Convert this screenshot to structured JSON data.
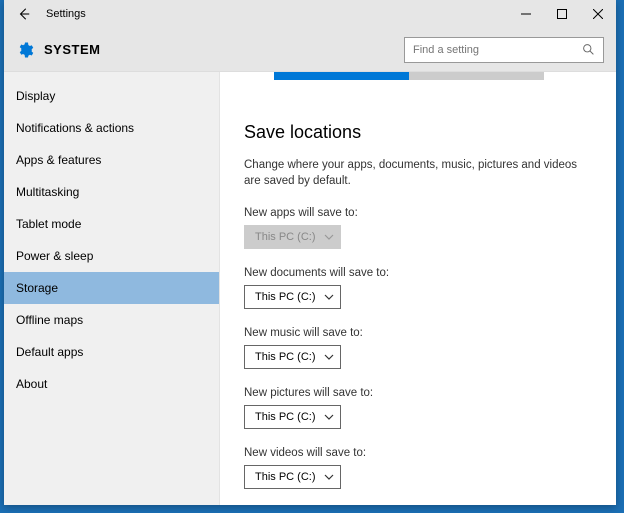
{
  "titlebar": {
    "title": "Settings"
  },
  "header": {
    "title": "SYSTEM"
  },
  "search": {
    "placeholder": "Find a setting"
  },
  "sidebar": {
    "items": [
      "Display",
      "Notifications & actions",
      "Apps & features",
      "Multitasking",
      "Tablet mode",
      "Power & sleep",
      "Storage",
      "Offline maps",
      "Default apps",
      "About"
    ],
    "selected_index": 6
  },
  "main": {
    "title": "Save locations",
    "description": "Change where your apps, documents, music, pictures and videos are saved by default.",
    "settings": [
      {
        "label": "New apps will save to:",
        "value": "This PC (C:)",
        "disabled": true
      },
      {
        "label": "New documents will save to:",
        "value": "This PC (C:)",
        "disabled": false
      },
      {
        "label": "New music will save to:",
        "value": "This PC (C:)",
        "disabled": false
      },
      {
        "label": "New pictures will save to:",
        "value": "This PC (C:)",
        "disabled": false
      },
      {
        "label": "New videos will save to:",
        "value": "This PC (C:)",
        "disabled": false
      }
    ]
  }
}
